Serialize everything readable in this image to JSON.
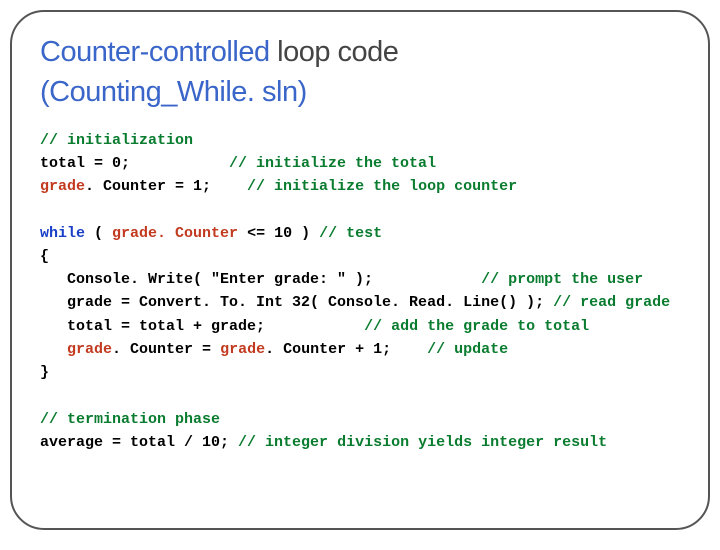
{
  "title": {
    "accent1": "Counter-controlled",
    "plain1": " loop code",
    "accent2": "(Counting_While. sln)"
  },
  "code": {
    "c0": "// initialization",
    "l1a": "total = 0;           ",
    "c1": "// initialize the total",
    "l2a": "grade",
    "l2b": ". Counter = 1;    ",
    "c2": "// initialize the loop counter",
    "l3a": "while",
    "l3b": " ( ",
    "l3c": "grade. Counter",
    "l3d": " <= 10 ) ",
    "c3": "// test",
    "l4": "{",
    "l5a": "   Console. Write( \"Enter grade: \" );            ",
    "c5": "// prompt the user",
    "l6a": "   grade = Convert. To. Int 32( Console. Read. Line() ); ",
    "c6": "// read grade",
    "l7a": "   total = total + grade;           ",
    "c7": "// add the grade to total",
    "l8a": "   ",
    "l8b1": "grade",
    "l8b2": ". Counter = ",
    "l8c1": "grade",
    "l8c2": ". Counter + 1;",
    "l8d": "    ",
    "c8": "// update",
    "l9": "}",
    "c10": "// termination phase",
    "l11": "average = total / 10; ",
    "c11": "// integer division yields integer result"
  }
}
